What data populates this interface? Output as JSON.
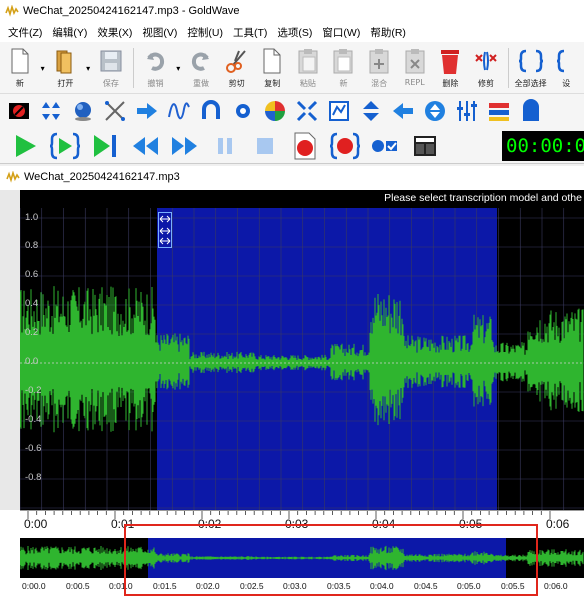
{
  "window": {
    "title": "WeChat_20250424162147.mp3 - GoldWave"
  },
  "menu": [
    "文件(Z)",
    "编辑(Y)",
    "效果(X)",
    "视图(V)",
    "控制(U)",
    "工具(T)",
    "选项(S)",
    "窗口(W)",
    "帮助(R)"
  ],
  "toolbar": {
    "new": "新",
    "open": "打开",
    "save": "保存",
    "undo": "撤销",
    "redo": "重做",
    "cut": "剪切",
    "copy": "复制",
    "paste": "粘贴",
    "paste_new": "新",
    "mix": "混合",
    "replace": "REPL",
    "delete": "删除",
    "trim": "修剪",
    "select_all": "全部选择",
    "settings": "设"
  },
  "timecode": "00:00:00",
  "document": {
    "title": "WeChat_20250424162147.mp3",
    "banner": "Please select transcription model and othe",
    "y_axis": [
      "1.0",
      "0.8",
      "0.6",
      "0.4",
      "0.2",
      "0.0",
      "-0.2",
      "-0.4",
      "-0.6",
      "-0.8"
    ],
    "ruler": [
      "0:00",
      "0:01",
      "0:02",
      "0:03",
      "0:04",
      "0:05",
      "0:06"
    ],
    "overview_ruler": [
      "0:00.0",
      "0:00.5",
      "0:01.0",
      "0:01.5",
      "0:02.0",
      "0:02.5",
      "0:03.0",
      "0:03.5",
      "0:04.0",
      "0:04.5",
      "0:05.0",
      "0:05.5",
      "0:06.0"
    ]
  },
  "colors": {
    "waveform": "#2fb52f",
    "selection": "#0c18a8",
    "timecode": "#00ff00",
    "highlight_box": "#e0261c"
  }
}
